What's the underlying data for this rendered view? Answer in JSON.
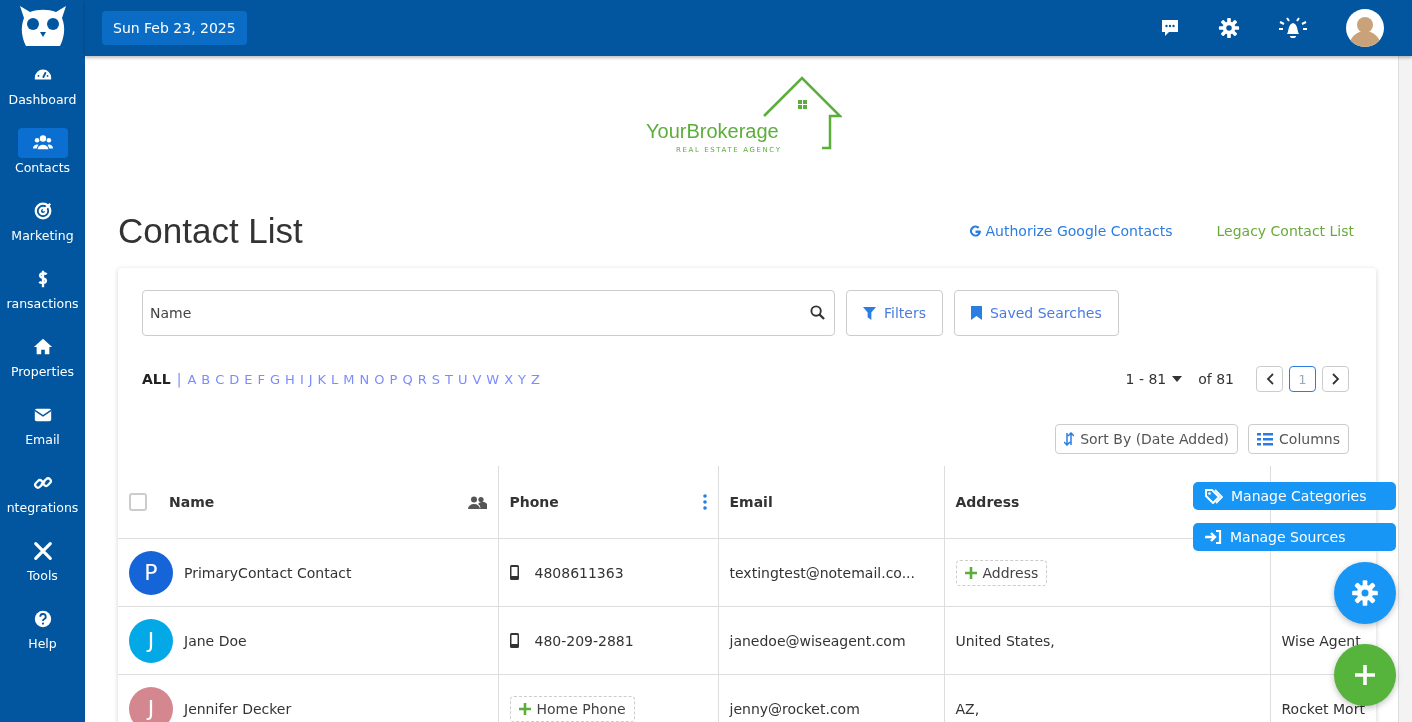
{
  "sidebar": {
    "items": [
      {
        "label": "Dashboard",
        "selected": false
      },
      {
        "label": "Contacts",
        "selected": true
      },
      {
        "label": "Marketing",
        "selected": false
      },
      {
        "label": "ransactions",
        "selected": false
      },
      {
        "label": "Properties",
        "selected": false
      },
      {
        "label": "Email",
        "selected": false
      },
      {
        "label": "ntegrations",
        "selected": false
      },
      {
        "label": "Tools",
        "selected": false
      },
      {
        "label": "Help",
        "selected": false
      }
    ]
  },
  "topbar": {
    "date": "Sun Feb 23, 2025"
  },
  "brand": {
    "name": "YourBrokerage",
    "tagline": "REAL ESTATE AGENCY"
  },
  "page": {
    "title": "Contact List",
    "links": [
      {
        "label": "Authorize Google Contacts",
        "kind": "google"
      },
      {
        "label": "Legacy Contact List",
        "kind": "legacy"
      }
    ]
  },
  "search": {
    "placeholder": "Name"
  },
  "toolbar": {
    "filters": "Filters",
    "saved_searches": "Saved Searches",
    "sort": "Sort By (Date Added)",
    "columns": "Columns"
  },
  "alphabet": {
    "separator": "|",
    "letters": [
      {
        "label": "ALL",
        "selected": true
      },
      {
        "label": "A",
        "selected": false
      },
      {
        "label": "B",
        "selected": false
      },
      {
        "label": "C",
        "selected": false
      },
      {
        "label": "D",
        "selected": false
      },
      {
        "label": "E",
        "selected": false
      },
      {
        "label": "F",
        "selected": false
      },
      {
        "label": "G",
        "selected": false
      },
      {
        "label": "H",
        "selected": false
      },
      {
        "label": "I",
        "selected": false
      },
      {
        "label": "J",
        "selected": false
      },
      {
        "label": "K",
        "selected": false
      },
      {
        "label": "L",
        "selected": false
      },
      {
        "label": "M",
        "selected": false
      },
      {
        "label": "N",
        "selected": false
      },
      {
        "label": "O",
        "selected": false
      },
      {
        "label": "P",
        "selected": false
      },
      {
        "label": "Q",
        "selected": false
      },
      {
        "label": "R",
        "selected": false
      },
      {
        "label": "S",
        "selected": false
      },
      {
        "label": "T",
        "selected": false
      },
      {
        "label": "U",
        "selected": false
      },
      {
        "label": "V",
        "selected": false
      },
      {
        "label": "W",
        "selected": false
      },
      {
        "label": "X",
        "selected": false
      },
      {
        "label": "Y",
        "selected": false
      },
      {
        "label": "Z",
        "selected": false
      }
    ]
  },
  "pagination": {
    "range": "1 - 81",
    "total": "of 81",
    "pages": [
      {
        "label": "1",
        "selected": true
      }
    ]
  },
  "table": {
    "select_all": {
      "checked": false
    },
    "columns": [
      "Name",
      "Phone",
      "Email",
      "Address"
    ],
    "rows": [
      {
        "initial": "P",
        "color": "#1565d8",
        "name": "PrimaryContact Contact",
        "phone": {
          "kind": "number",
          "text": "4808611363"
        },
        "email": "textingtest@notemail.co...",
        "address": {
          "kind": "add",
          "text": "Address"
        }
      },
      {
        "initial": "J",
        "color": "#03a9e6",
        "name": "Jane Doe",
        "phone": {
          "kind": "number",
          "text": "480-209-2881"
        },
        "email": "janedoe@wiseagent.com",
        "address": {
          "kind": "text",
          "text": "United States,"
        },
        "column_5": "Wise Agent"
      },
      {
        "initial": "J",
        "color": "#d4878e",
        "name": "Jennifer Decker",
        "phone": {
          "kind": "add",
          "text": "Home Phone"
        },
        "email": "jenny@rocket.com",
        "address": {
          "kind": "text",
          "text": "AZ,"
        },
        "column_5": "Rocket Mort"
      }
    ]
  },
  "actions": [
    {
      "kind": "categories",
      "label": "Manage Categories"
    },
    {
      "kind": "sources",
      "label": "Manage Sources"
    }
  ]
}
